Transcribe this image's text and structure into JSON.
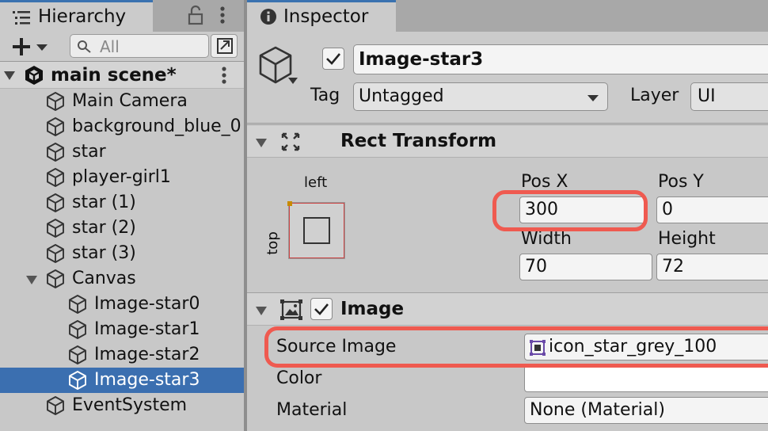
{
  "hierarchy": {
    "tab_label": "Hierarchy",
    "search_placeholder": "All",
    "scene_name": "main scene*",
    "items": [
      {
        "label": "Main Camera",
        "depth": 1
      },
      {
        "label": "background_blue_0",
        "depth": 1
      },
      {
        "label": "star",
        "depth": 1
      },
      {
        "label": "player-girl1",
        "depth": 1
      },
      {
        "label": "star (1)",
        "depth": 1
      },
      {
        "label": "star (2)",
        "depth": 1
      },
      {
        "label": "star (3)",
        "depth": 1
      },
      {
        "label": "Canvas",
        "depth": 1,
        "expanded": true
      },
      {
        "label": "Image-star0",
        "depth": 2
      },
      {
        "label": "Image-star1",
        "depth": 2
      },
      {
        "label": "Image-star2",
        "depth": 2
      },
      {
        "label": "Image-star3",
        "depth": 2,
        "selected": true
      },
      {
        "label": "EventSystem",
        "depth": 1
      }
    ]
  },
  "inspector": {
    "tab_label": "Inspector",
    "object_name": "Image-star3",
    "active": true,
    "tag_label": "Tag",
    "tag_value": "Untagged",
    "layer_label": "Layer",
    "layer_value": "UI",
    "rect_transform": {
      "title": "Rect Transform",
      "anchor_h": "left",
      "anchor_v": "top",
      "pos_x_label": "Pos X",
      "pos_x": "300",
      "pos_y_label": "Pos Y",
      "pos_y": "0",
      "width_label": "Width",
      "width": "70",
      "height_label": "Height",
      "height": "72"
    },
    "image": {
      "title": "Image",
      "enabled": true,
      "source_image_label": "Source Image",
      "source_image_value": "icon_star_grey_100",
      "color_label": "Color",
      "material_label": "Material",
      "material_value": "None (Material)"
    }
  },
  "colors": {
    "selection": "#3b6fb0",
    "highlight": "#ef5a50",
    "panel": "#c8c8c8"
  },
  "icons": [
    "hierarchy-list-icon",
    "lock-icon",
    "kebab-icon",
    "plus-icon",
    "search-icon",
    "unity-logo-icon",
    "gameobject-cube-icon",
    "info-icon",
    "rect-transform-icon",
    "image-component-icon",
    "sprite-icon"
  ]
}
